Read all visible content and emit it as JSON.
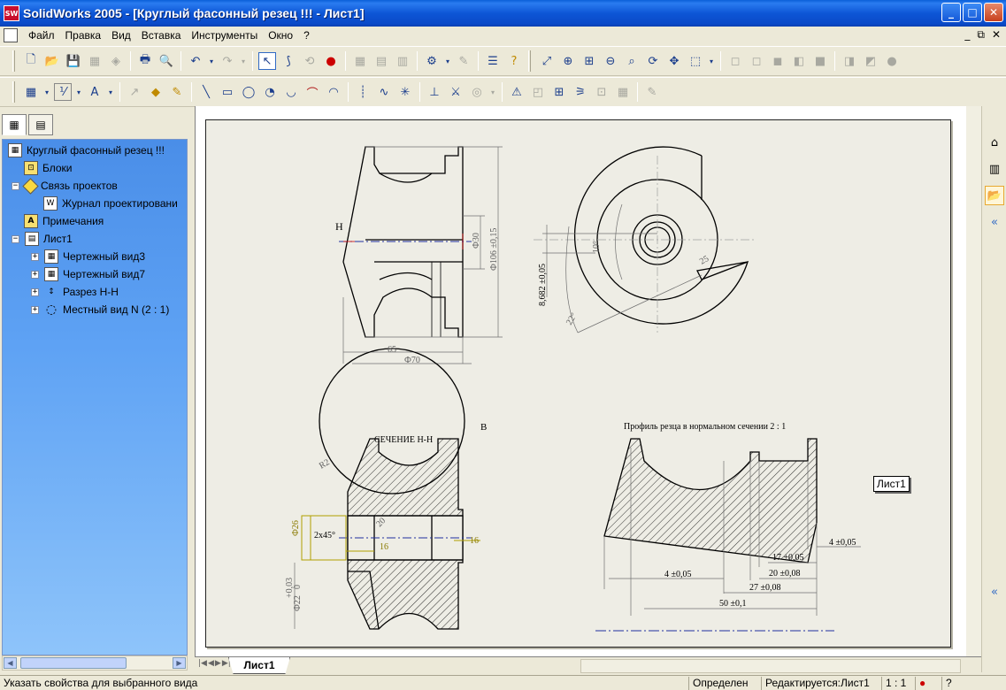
{
  "window": {
    "title": "SolidWorks 2005 - [Круглый фасонный резец !!! - Лист1]",
    "app_icon_label": "SW",
    "minimize": "_",
    "maximize": "□",
    "close": "✕"
  },
  "menu": {
    "items": [
      "Файл",
      "Правка",
      "Вид",
      "Вставка",
      "Инструменты",
      "Окно",
      "?"
    ],
    "mdi_buttons": [
      "_",
      "⧉",
      "✕"
    ]
  },
  "feature_tree": {
    "tabs": [
      "feature-manager",
      "property-manager"
    ],
    "nodes": [
      {
        "label": "Круглый фасонный резец !!!",
        "level": 0,
        "expander": "",
        "icon": "drawing-icon"
      },
      {
        "label": "Блоки",
        "level": 1,
        "expander": "",
        "icon": "folder-icon"
      },
      {
        "label": "Связь проектов",
        "level": 1,
        "expander": "−",
        "icon": "diamond-icon"
      },
      {
        "label": "Журнал проектировани",
        "level": 2,
        "expander": "",
        "icon": "document-icon"
      },
      {
        "label": "Примечания",
        "level": 1,
        "expander": "",
        "icon": "annotation-icon"
      },
      {
        "label": "Лист1",
        "level": 1,
        "expander": "−",
        "icon": "sheet-icon"
      },
      {
        "label": "Чертежный вид3",
        "level": 2,
        "expander": "+",
        "icon": "drawing-view-icon"
      },
      {
        "label": "Чертежный вид7",
        "level": 2,
        "expander": "+",
        "icon": "drawing-view-icon"
      },
      {
        "label": "Разрез Н-Н",
        "level": 2,
        "expander": "+",
        "icon": "section-view-icon"
      },
      {
        "label": "Местный вид N (2 : 1)",
        "level": 2,
        "expander": "+",
        "icon": "detail-view-icon"
      }
    ]
  },
  "drawing": {
    "labels": {
      "h_marker": "Н",
      "b_marker": "B",
      "section_title": "СЕЧЕНИЕ Н-Н",
      "profile_title": "Профиль резца в нормальном сечении 2 : 1",
      "dim_65": "65",
      "dim_70": "Ф70",
      "dim_30": "Ф30",
      "dim_106": "Ф106 ±0,15",
      "dim_10deg": "10°",
      "dim_22deg": "22°",
      "dim_25": "25",
      "dim_8682": "8,682 ±0,05",
      "dim_26": "Ф26",
      "dim_2x45": "2x45°",
      "dim_16a": "16",
      "dim_16b": "16",
      "dim_tol": "+0,03",
      "dim_tol0": "0",
      "dim_22": "Ф22",
      "dim_r2": "R2",
      "dim_20": "20",
      "dim_4a": "4 ±0,05",
      "dim_4b": "4 ±0,05",
      "dim_17": "17 ±0,05",
      "dim_20b": "20 ±0,08",
      "dim_27": "27 ±0,08",
      "dim_50": "50 ±0,1"
    }
  },
  "tooltip": {
    "text": "Лист1"
  },
  "sheet_tabs": {
    "nav": [
      "|◀",
      "◀",
      "▶",
      "▶|"
    ],
    "active": "Лист1"
  },
  "status": {
    "hint": "Указать свойства для выбранного вида",
    "state": "Определен",
    "editing": "Редактируется:Лист1",
    "scale": "1 : 1"
  }
}
